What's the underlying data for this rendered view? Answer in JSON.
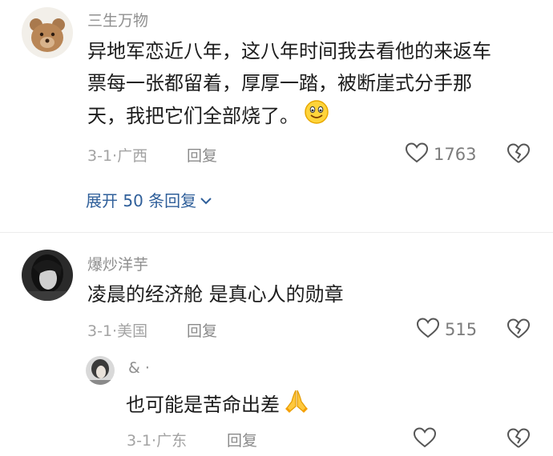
{
  "comments": [
    {
      "username": "三生万物",
      "text_line1": "异地军恋近八年，这八年时间我去看他的来返车",
      "text_line2": "票每一张都留着，厚厚一踏，被断崖式分手那",
      "text_line3": "天，我把它们全部烧了。",
      "emoji": "smile-emoji",
      "meta": "3-1·广西",
      "reply_label": "回复",
      "likes": "1763",
      "expand_label": "展开 50 条回复"
    },
    {
      "username": "爆炒洋芋",
      "text": "凌晨的经济舱 是真心人的勋章",
      "meta": "3-1·美国",
      "reply_label": "回复",
      "likes": "515",
      "reply": {
        "username": "& ·",
        "text": "也可能是苦命出差",
        "emoji": "praying-hands-emoji",
        "meta": "3-1·广东",
        "reply_label": "回复"
      }
    }
  ],
  "colors": {
    "username": "#8f8f8f",
    "text": "#1c1c1c",
    "meta": "#a3a3a3",
    "link": "#2f5f9a"
  }
}
